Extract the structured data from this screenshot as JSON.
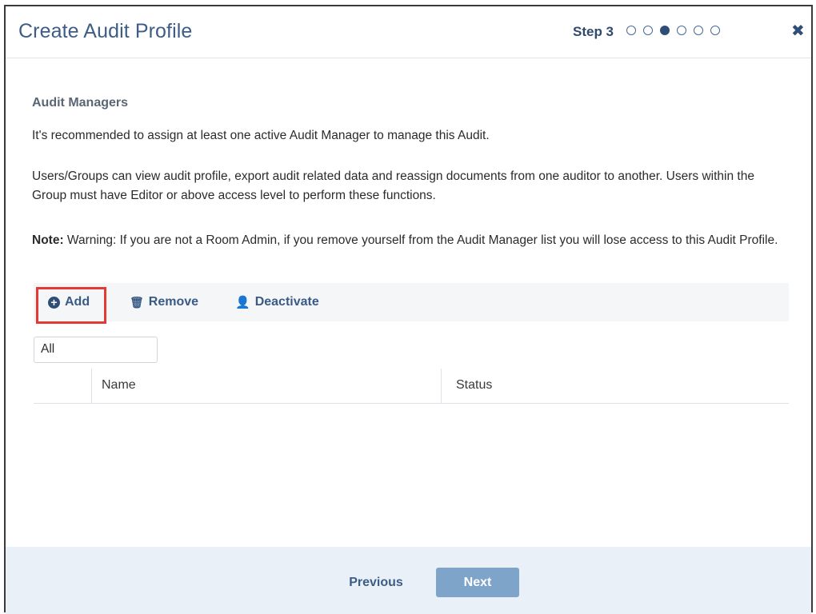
{
  "dialog": {
    "title": "Create Audit Profile",
    "step_label": "Step 3",
    "steps_total": 6,
    "current_step": 3,
    "close_icon": "close-icon"
  },
  "section": {
    "title": "Audit Managers",
    "paragraph1": "It's recommended to assign at least one active Audit Manager to manage this Audit.",
    "paragraph2": "Users/Groups can view audit profile, export audit related data and reassign documents from one auditor to another. Users within the Group must have Editor or above access level to perform these functions.",
    "note_label": "Note:",
    "note_text": " Warning: If you are not a Room Admin, if you remove yourself from the Audit Manager list you will lose access to this Audit Profile."
  },
  "toolbar": {
    "add_label": "Add",
    "add_icon": "circle-plus-icon",
    "remove_label": "Remove",
    "remove_icon": "trash-icon",
    "deactivate_label": "Deactivate",
    "deactivate_icon": "user-x-icon"
  },
  "filter": {
    "value": "All"
  },
  "grid": {
    "columns": [
      "Name",
      "Status"
    ],
    "rows": []
  },
  "footer": {
    "previous_label": "Previous",
    "next_label": "Next"
  },
  "colors": {
    "accent": "#3d5d86",
    "footer_bg": "#e9f0f7",
    "next_button": "#7fa4c9",
    "highlight": "#e53935"
  }
}
